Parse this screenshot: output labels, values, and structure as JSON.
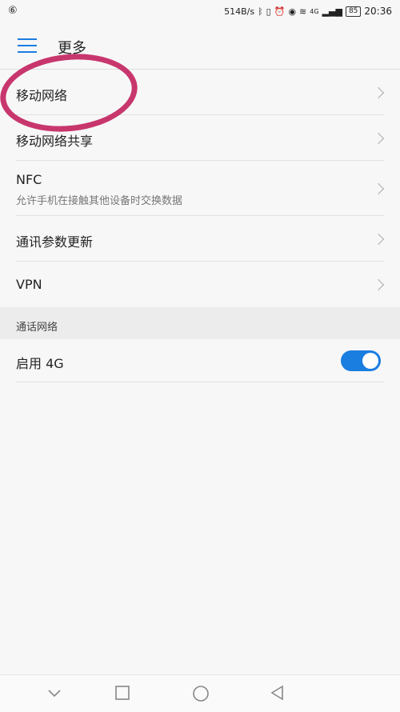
{
  "status_bar": {
    "left_icon": "weibo-icon",
    "speed": "514B/s",
    "network": "4G",
    "battery": "85",
    "time": "20:36"
  },
  "header": {
    "title": "更多"
  },
  "items": [
    {
      "label": "移动网络",
      "sub": ""
    },
    {
      "label": "移动网络共享",
      "sub": ""
    },
    {
      "label": "NFC",
      "sub": "允许手机在接触其他设备时交换数据"
    },
    {
      "label": "通讯参数更新",
      "sub": ""
    },
    {
      "label": "VPN",
      "sub": ""
    }
  ],
  "section": {
    "title": "通话网络"
  },
  "toggle_item": {
    "label": "启用 4G",
    "enabled": true
  },
  "colors": {
    "accent": "#1a7de0",
    "annotation": "#c8366e"
  }
}
